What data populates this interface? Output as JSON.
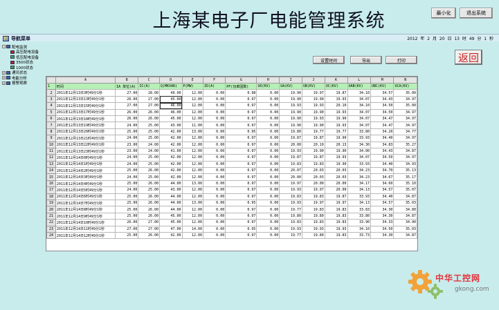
{
  "header": {
    "title": "上海某电子厂电能管理系统",
    "min_label": "最小化",
    "exit_label": "退出系统"
  },
  "nav": {
    "title": "导航菜单",
    "datetime": "2012 年 2 月 20 日 13 时 49 分 1 秒",
    "tree": [
      {
        "label": "配电监测",
        "level": 1,
        "expanded": true,
        "icon": "folder-icon"
      },
      {
        "label": "高压配电设备",
        "level": 2,
        "icon": "device-icon"
      },
      {
        "label": "低压配电设备",
        "level": 2,
        "icon": "device-icon"
      },
      {
        "label": "3500状态",
        "level": 2,
        "icon": "device-icon"
      },
      {
        "label": "1000状态",
        "level": 2,
        "icon": "device-icon"
      },
      {
        "label": "通讯状态",
        "level": 1,
        "expanded": false,
        "icon": "folder-icon"
      },
      {
        "label": "电能分析",
        "level": 1,
        "expanded": false,
        "icon": "folder-icon"
      },
      {
        "label": "报警观察",
        "level": 1,
        "expanded": false,
        "icon": "folder-icon"
      }
    ]
  },
  "toolbar": {
    "set_time": "设置时间",
    "export": "导出",
    "print": "打印",
    "back": "返回"
  },
  "sheet": {
    "col_letters": [
      "",
      "A",
      "B",
      "C",
      "D",
      "E",
      "F",
      "G",
      "H",
      "I",
      "J",
      "K",
      "L",
      "M",
      "N"
    ],
    "headers": [
      "时间",
      "IA 单位(A)",
      "IC(A)",
      "Q(MKVAR)",
      "P(MW)",
      "ID(A)",
      "PF(功率因数)",
      "UO(KV)",
      "UA(KV)",
      "UB(KV)",
      "UC(KV)",
      "UAB(KV)",
      "UBC(KV)",
      "UCA(KV)"
    ],
    "rows": [
      [
        "2011年12月13日3时49分1秒",
        "27.00",
        "28.00",
        "49.00",
        "12.00",
        "0.00",
        "0.98",
        "0.00",
        "19.90",
        "19.97",
        "19.87",
        "34.10",
        "34.57",
        "35.00"
      ],
      [
        "2011年12月13日13时49分1秒",
        "26.00",
        "27.00",
        "45.00",
        "12.00",
        "0.00",
        "0.97",
        "0.00",
        "19.90",
        "19.90",
        "19.93",
        "34.07",
        "34.43",
        "34.97"
      ],
      [
        "2011年12月13日15时49分1秒",
        "27.00",
        "27.00",
        "46.00",
        "12.00",
        "0.00",
        "0.97",
        "0.00",
        "19.93",
        "19.93",
        "20.10",
        "34.10",
        "34.50",
        "35.00"
      ],
      [
        "2011年12月13日17时49分1秒",
        "26.00",
        "26.00",
        "46.00",
        "12.00",
        "0.00",
        "0.97",
        "0.00",
        "19.90",
        "19.90",
        "19.93",
        "34.07",
        "34.50",
        "34.97"
      ],
      [
        "2011年12月13日18时49分1秒",
        "26.00",
        "26.00",
        "45.00",
        "12.00",
        "0.00",
        "0.97",
        "0.00",
        "19.90",
        "19.93",
        "19.90",
        "34.07",
        "34.47",
        "34.97"
      ],
      [
        "2011年12月13日19时49分1秒",
        "24.00",
        "25.00",
        "43.00",
        "11.00",
        "0.00",
        "0.97",
        "0.00",
        "19.90",
        "19.90",
        "19.93",
        "34.07",
        "34.47",
        "34.97"
      ],
      [
        "2011年12月13日20时49分1秒",
        "25.00",
        "25.00",
        "42.00",
        "13.00",
        "0.00",
        "0.95",
        "0.00",
        "19.80",
        "19.77",
        "19.77",
        "33.80",
        "34.20",
        "34.77"
      ],
      [
        "2011年12月13日21时49分1秒",
        "24.00",
        "25.00",
        "42.00",
        "12.00",
        "0.00",
        "0.97",
        "0.00",
        "19.87",
        "19.87",
        "19.90",
        "33.93",
        "34.40",
        "34.97"
      ],
      [
        "2011年12月13日22时49分1秒",
        "23.00",
        "24.00",
        "42.00",
        "12.00",
        "0.00",
        "0.97",
        "0.00",
        "20.00",
        "20.10",
        "20.13",
        "34.30",
        "34.83",
        "35.27"
      ],
      [
        "2011年12月13日23时49分1秒",
        "23.00",
        "24.00",
        "41.00",
        "12.00",
        "0.00",
        "0.97",
        "0.00",
        "19.93",
        "19.90",
        "19.90",
        "34.00",
        "34.43",
        "34.87"
      ],
      [
        "2011年12月14日0时49分1秒",
        "24.00",
        "25.00",
        "42.00",
        "12.00",
        "0.00",
        "0.97",
        "0.00",
        "19.87",
        "19.87",
        "19.93",
        "34.07",
        "34.50",
        "34.97"
      ],
      [
        "2011年12月14日1时49分1秒",
        "24.00",
        "25.00",
        "42.00",
        "12.00",
        "0.00",
        "0.97",
        "0.00",
        "19.83",
        "19.83",
        "19.90",
        "33.93",
        "34.40",
        "34.93"
      ],
      [
        "2011年12月14日2时49分1秒",
        "25.00",
        "26.00",
        "42.00",
        "12.00",
        "0.00",
        "0.97",
        "0.00",
        "20.07",
        "20.03",
        "20.03",
        "34.23",
        "34.70",
        "35.13"
      ],
      [
        "2011年12月14日3时49分1秒",
        "24.00",
        "25.00",
        "42.00",
        "12.00",
        "0.00",
        "0.97",
        "0.00",
        "20.00",
        "20.03",
        "20.03",
        "34.23",
        "34.67",
        "35.17"
      ],
      [
        "2011年12月14日4时49分1秒",
        "25.00",
        "26.00",
        "44.00",
        "13.00",
        "0.00",
        "0.97",
        "0.00",
        "19.97",
        "20.00",
        "20.00",
        "34.17",
        "34.60",
        "35.10"
      ],
      [
        "2011年12月14日5时49分1秒",
        "24.00",
        "25.00",
        "43.00",
        "12.00",
        "0.00",
        "0.97",
        "0.00",
        "19.93",
        "19.97",
        "20.00",
        "34.13",
        "34.57",
        "35.07"
      ],
      [
        "2011年12月14日6时49分1秒",
        "25.00",
        "26.00",
        "44.00",
        "12.00",
        "0.00",
        "0.97",
        "0.00",
        "19.83",
        "19.83",
        "19.87",
        "33.93",
        "34.40",
        "34.87"
      ],
      [
        "2011年12月14日7时49分1秒",
        "25.00",
        "26.00",
        "44.00",
        "13.00",
        "0.00",
        "0.95",
        "0.00",
        "19.93",
        "19.97",
        "19.97",
        "34.13",
        "34.57",
        "35.03"
      ],
      [
        "2011年12月14日8时49分1秒",
        "25.00",
        "26.00",
        "44.00",
        "12.00",
        "0.00",
        "0.97",
        "0.00",
        "19.77",
        "19.83",
        "19.83",
        "33.83",
        "34.30",
        "34.80"
      ],
      [
        "2011年12月14日9时49分1秒",
        "25.00",
        "26.00",
        "45.00",
        "12.00",
        "0.00",
        "0.97",
        "0.00",
        "19.80",
        "19.80",
        "19.83",
        "33.80",
        "34.30",
        "34.87"
      ],
      [
        "2011年12月14日10时49分1秒",
        "26.00",
        "27.00",
        "45.00",
        "12.00",
        "0.00",
        "0.97",
        "0.00",
        "19.83",
        "19.83",
        "19.83",
        "33.90",
        "34.33",
        "34.90"
      ],
      [
        "2011年12月14日11时49分1秒",
        "27.00",
        "27.00",
        "47.00",
        "14.00",
        "0.00",
        "0.95",
        "0.00",
        "19.93",
        "19.93",
        "19.93",
        "34.10",
        "34.50",
        "35.03"
      ],
      [
        "2011年12月14日12时49分1秒",
        "25.00",
        "26.00",
        "42.00",
        "12.00",
        "0.00",
        "0.97",
        "0.00",
        "19.77",
        "19.80",
        "19.83",
        "33.73",
        "34.30",
        "34.87"
      ]
    ]
  },
  "watermark": {
    "cn": "中华工控网",
    "en": "gkong.com"
  }
}
